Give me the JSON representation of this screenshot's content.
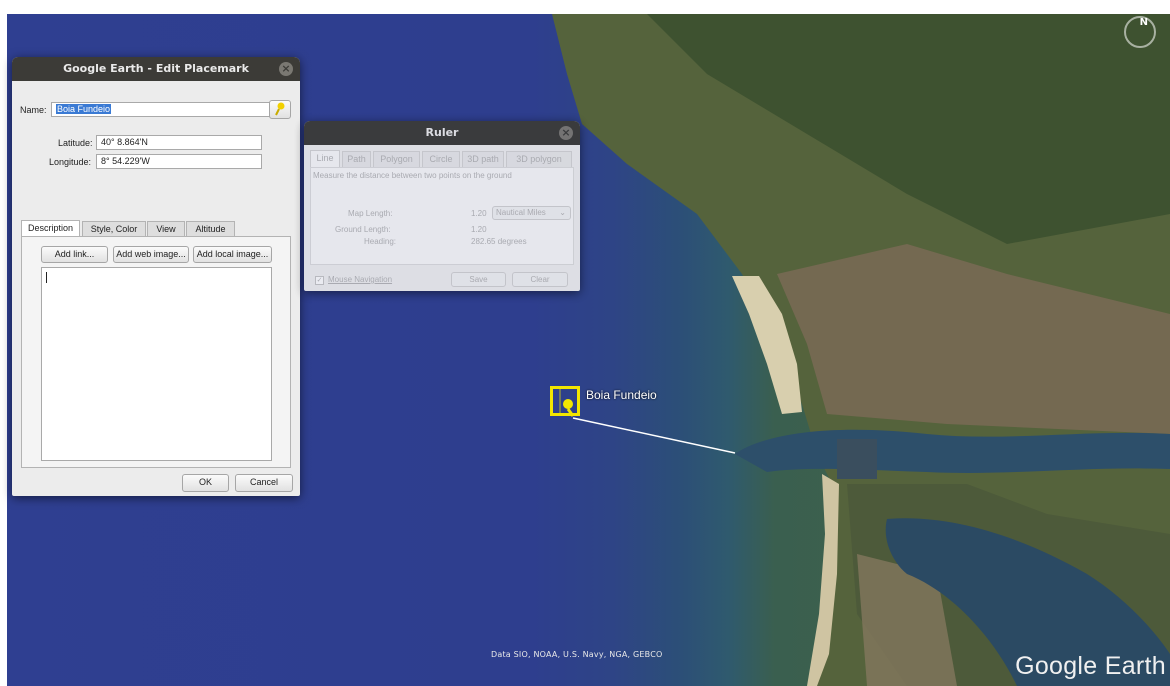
{
  "map": {
    "placemark_label": "Boia Fundeio",
    "attribution": "Data SIO, NOAA, U.S. Navy, NGA, GEBCO",
    "logo": "Google Earth",
    "compass": "N"
  },
  "edit_placemark": {
    "title": "Google Earth - Edit Placemark",
    "name_label": "Name:",
    "name_value": "Boia Fundeio",
    "latitude_label": "Latitude:",
    "latitude_value": "40° 8.864'N",
    "longitude_label": "Longitude:",
    "longitude_value": "8° 54.229'W",
    "tabs": [
      "Description",
      "Style, Color",
      "View",
      "Altitude"
    ],
    "add_link": "Add link...",
    "add_web_image": "Add web image...",
    "add_local_image": "Add local image...",
    "ok": "OK",
    "cancel": "Cancel",
    "close": "×"
  },
  "ruler": {
    "title": "Ruler",
    "tabs": [
      "Line",
      "Path",
      "Polygon",
      "Circle",
      "3D path",
      "3D polygon"
    ],
    "instructions": "Measure the distance between two points on the ground",
    "map_length_label": "Map Length:",
    "map_length_value": "1.20",
    "unit": "Nautical Miles",
    "ground_length_label": "Ground Length:",
    "ground_length_value": "1.20",
    "heading_label": "Heading:",
    "heading_value": "282.65 degrees",
    "mouse_navigation": "Mouse Navigation",
    "save": "Save",
    "clear": "Clear",
    "close": "×"
  }
}
